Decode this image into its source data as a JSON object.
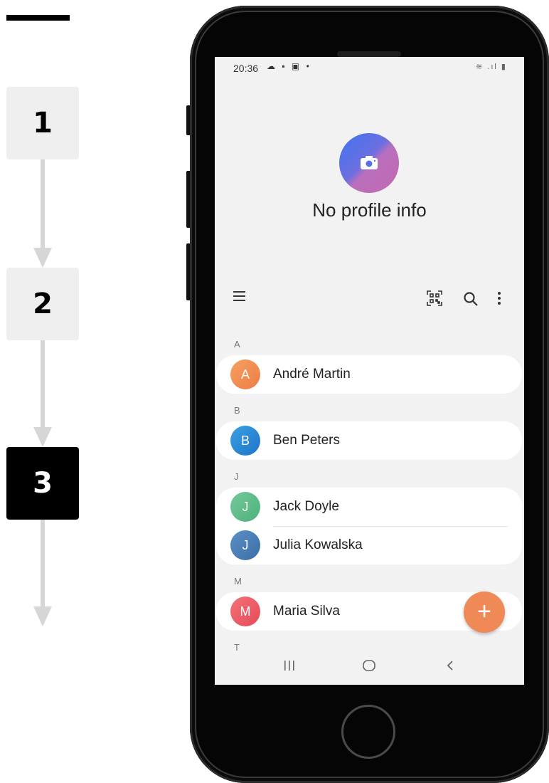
{
  "steps": [
    {
      "label": "1",
      "active": false
    },
    {
      "label": "2",
      "active": false
    },
    {
      "label": "3",
      "active": true
    }
  ],
  "status_bar": {
    "time": "20:36"
  },
  "profile": {
    "text": "No profile info"
  },
  "toolbar": {
    "icons": [
      "menu-icon",
      "qr-code-icon",
      "search-icon",
      "more-vert-icon"
    ]
  },
  "contacts": {
    "sections": [
      {
        "letter": "A",
        "entries": [
          {
            "initial": "A",
            "name": "André Martin",
            "color": "#f08f55"
          }
        ]
      },
      {
        "letter": "B",
        "entries": [
          {
            "initial": "B",
            "name": "Ben Peters",
            "color": "#2e8fd6"
          }
        ]
      },
      {
        "letter": "J",
        "entries": [
          {
            "initial": "J",
            "name": "Jack Doyle",
            "color": "#5fbf8a"
          },
          {
            "initial": "J",
            "name": "Julia Kowalska",
            "color": "#4a7fb8"
          }
        ]
      },
      {
        "letter": "M",
        "entries": [
          {
            "initial": "M",
            "name": "Maria Silva",
            "color": "#ef5d66"
          }
        ]
      },
      {
        "letter": "T",
        "entries": []
      }
    ]
  },
  "fab": {
    "label": "+",
    "color": "#ef8a57"
  }
}
